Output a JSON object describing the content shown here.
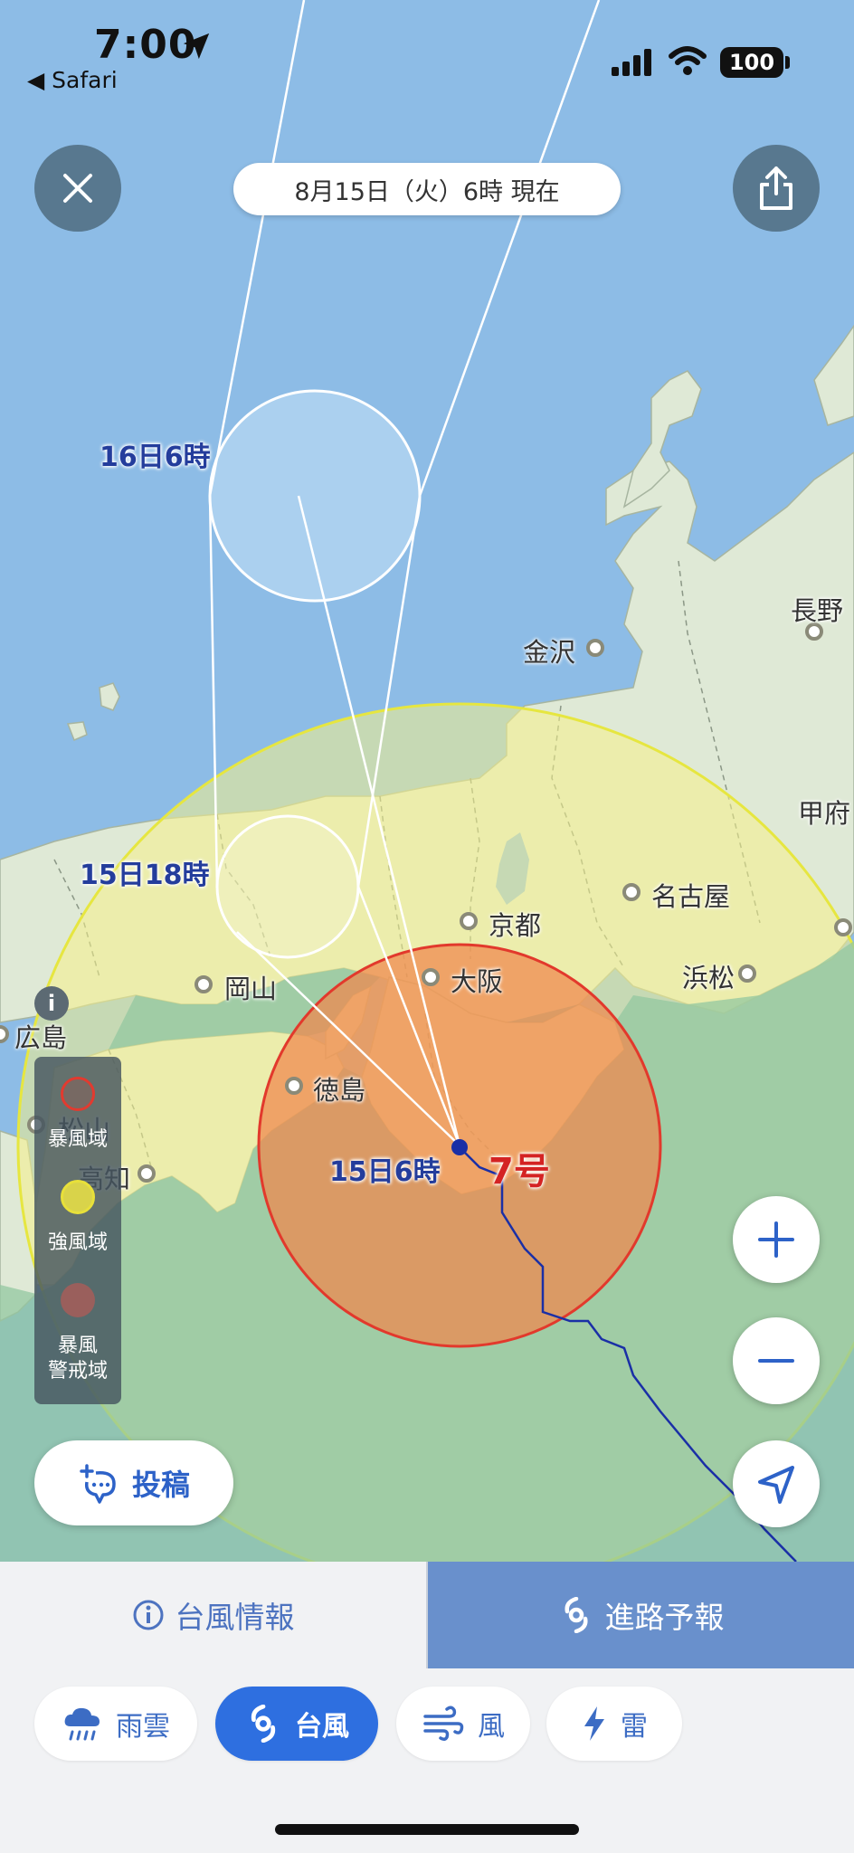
{
  "status_bar": {
    "time": "7:00",
    "back_app": "◀ Safari",
    "battery": "100"
  },
  "header": {
    "date_status": "8月15日（火）6時 現在"
  },
  "map": {
    "cities": [
      {
        "id": "kanazawa",
        "name": "金沢"
      },
      {
        "id": "nagano",
        "name": "長野"
      },
      {
        "id": "kofu",
        "name": "甲府"
      },
      {
        "id": "kyoto",
        "name": "京都"
      },
      {
        "id": "nagoya",
        "name": "名古屋"
      },
      {
        "id": "okayama",
        "name": "岡山"
      },
      {
        "id": "osaka",
        "name": "大阪"
      },
      {
        "id": "hamamatsu",
        "name": "浜松"
      },
      {
        "id": "hiroshima",
        "name": "広島"
      },
      {
        "id": "tokushima",
        "name": "徳島"
      },
      {
        "id": "matsuyama",
        "name": "松山"
      },
      {
        "id": "kochi",
        "name": "高知"
      }
    ],
    "forecast_labels": [
      "16日6時",
      "15日18時",
      "15日6時"
    ],
    "typhoon_label": "7号",
    "colors": {
      "storm_area": "#f0864c",
      "strong_wind_area": "#f8f3a0",
      "warning_area": "#b0848a",
      "track": "#1a2fa6"
    }
  },
  "legend": {
    "storm_label": "暴風域",
    "strong_wind_label": "強風域",
    "warning_label": "暴風\n警戒域"
  },
  "post_button": {
    "label": "投稿"
  },
  "tabs": {
    "info_label": "台風情報",
    "route_label": "進路予報"
  },
  "layers": [
    {
      "label": "雨雲",
      "icon": "cloud-rain-icon",
      "active": false
    },
    {
      "label": "台風",
      "icon": "typhoon-icon",
      "active": true
    },
    {
      "label": "風",
      "icon": "wind-icon",
      "active": false
    },
    {
      "label": "雷",
      "icon": "lightning-icon",
      "active": false
    }
  ]
}
